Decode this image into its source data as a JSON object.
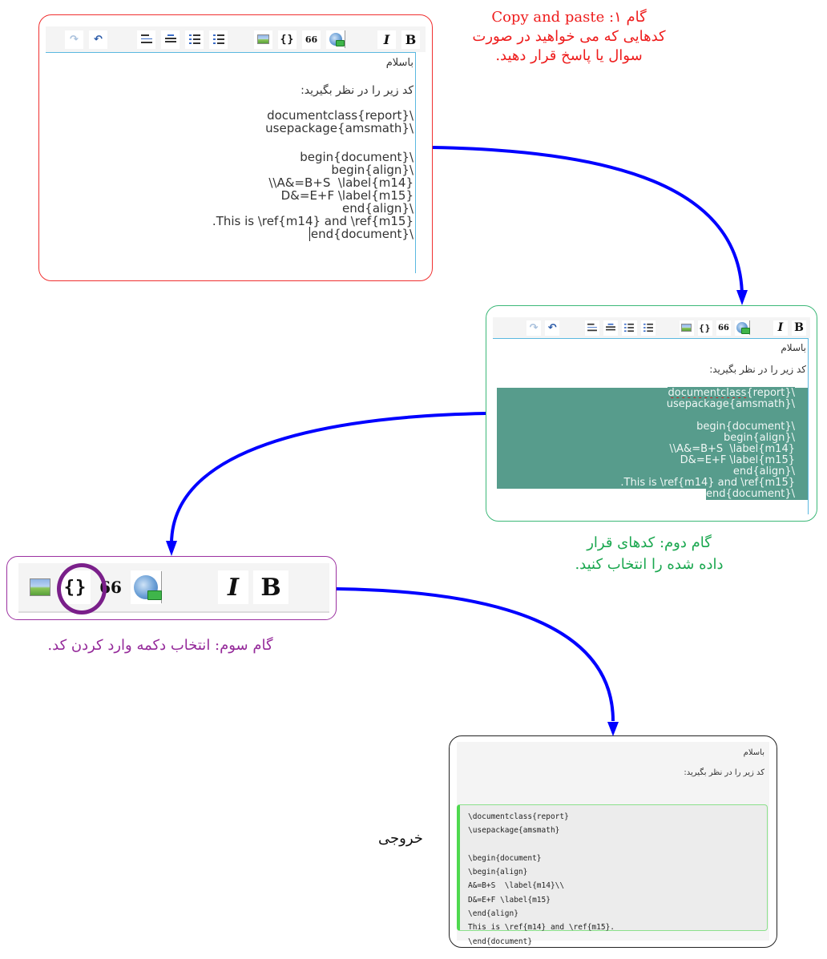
{
  "colors": {
    "step1": "#ee1c1c",
    "step2": "#1aa74f",
    "step3": "#952a9a",
    "arrow": "#0000ff",
    "selection": "#579c8c",
    "code_border": "#4fd94f"
  },
  "toolbar": {
    "icons": [
      "redo-icon",
      "undo-icon",
      "align-right-icon",
      "align-center-icon",
      "bullet-list-icon",
      "numbered-list-icon",
      "insert-image-icon",
      "code-icon",
      "quote-icon",
      "insert-link-icon",
      "italic-icon",
      "bold-icon"
    ],
    "code_label": "{}",
    "quote_label": "66",
    "italic_label": "I",
    "bold_label": "B",
    "redo_label": "↷",
    "undo_label": "↶"
  },
  "step1": {
    "caption_line1": "گام ۱: Copy and paste",
    "caption_line2": "کدهایی که می خواهید در صورت",
    "caption_line3": "سوال یا پاسخ قرار دهید.",
    "greeting": "باسلام",
    "intro": "کد زیر را در نظر بگیرید:",
    "code_lines": [
      "\\documentclass{report}",
      "\\usepackage{amsmath}",
      "",
      "\\begin{document}",
      "\\begin{align}",
      "A&=B+S  \\label{m14}\\\\",
      "D&=E+F \\label{m15}",
      "\\end{align}",
      "This is \\ref{m14} and \\ref{m15}.",
      "\\end{document}"
    ]
  },
  "step2": {
    "caption_line1": "گام دوم:  کدهای قرار",
    "caption_line2": "داده شده را انتخاب کنید.",
    "greeting": "باسلام",
    "intro": "کد زیر را در نظر بگیرید:"
  },
  "step3": {
    "caption": "گام سوم: انتخاب دکمه وارد کردن کد."
  },
  "output": {
    "label": "خروجی",
    "greeting": "باسلام",
    "intro": "کد زیر را در نظر بگیرید:",
    "code_lines": [
      "\\documentclass{report}",
      "\\usepackage{amsmath}",
      "",
      "\\begin{document}",
      "\\begin{align}",
      "A&=B+S  \\label{m14}\\\\",
      "D&=E+F \\label{m15}",
      "\\end{align}",
      "This is \\ref{m14} and \\ref{m15}.",
      "\\end{document}"
    ]
  }
}
